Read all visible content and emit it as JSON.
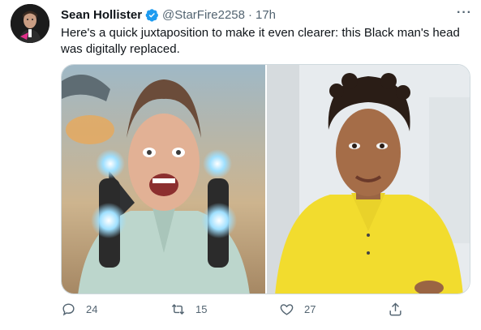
{
  "tweet": {
    "author_name": "Sean Hollister",
    "handle": "@StarFire2258",
    "separator": "·",
    "time": "17h",
    "text": "Here's a quick juxtaposition to make it even clearer: this Black man's head was digitally replaced.",
    "more_glyph": "···",
    "verified_color": "#1d9bf0"
  },
  "media": {
    "left_image": "stock-photo-man-with-neck-speaker",
    "right_image": "stock-photo-man-yellow-polo"
  },
  "actions": {
    "reply_count": "24",
    "retweet_count": "15",
    "like_count": "27"
  },
  "icons": [
    "reply-icon",
    "retweet-icon",
    "like-icon",
    "share-icon",
    "verified-icon",
    "more-icon"
  ]
}
